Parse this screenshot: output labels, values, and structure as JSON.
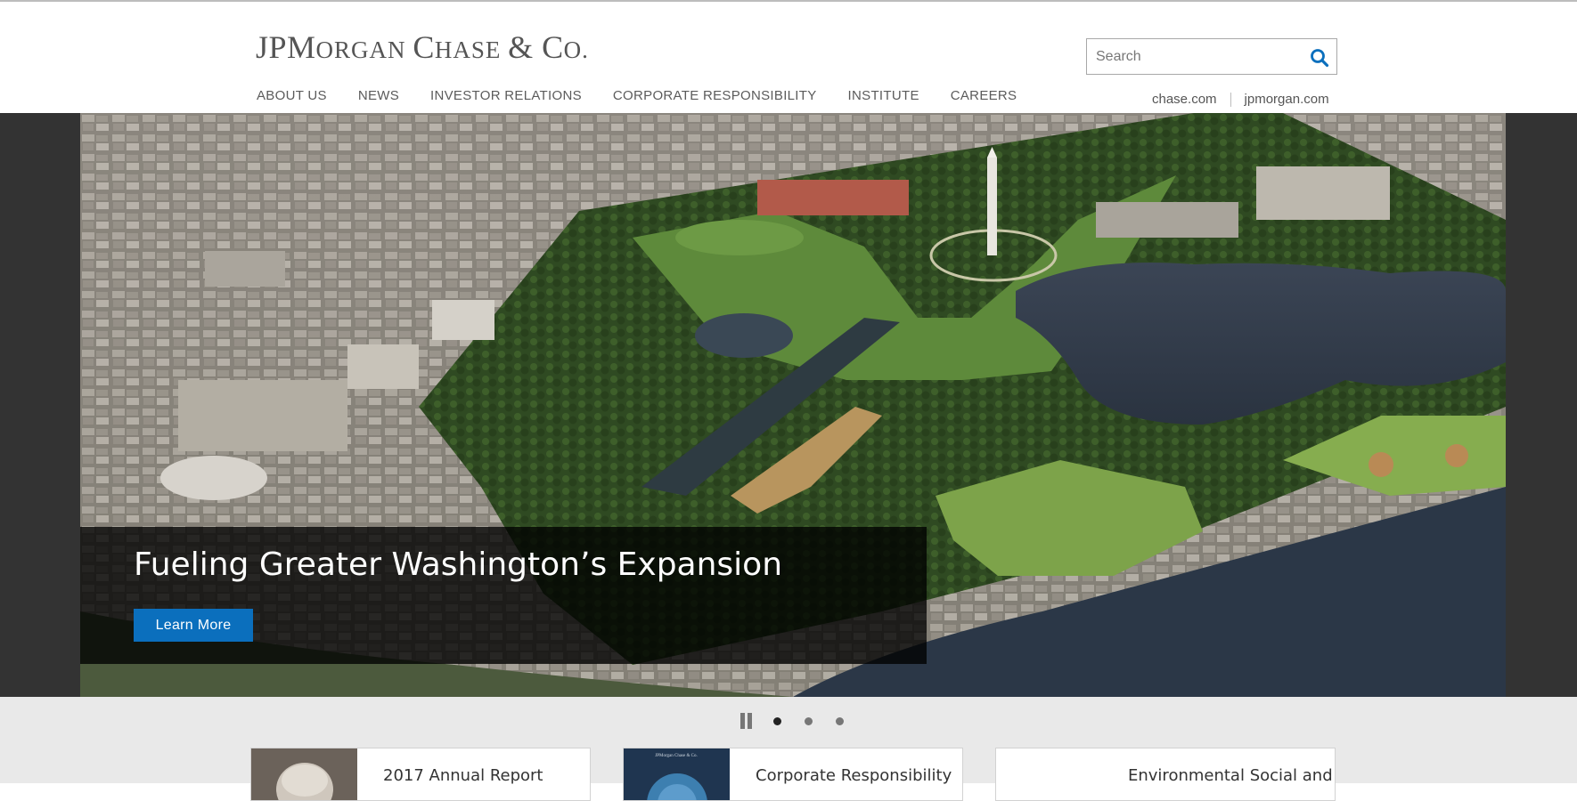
{
  "header": {
    "logo_text": "JPMorgan Chase & Co.",
    "logo_parts": [
      "JPM",
      "ORGAN ",
      "C",
      "HASE ",
      "& C",
      "O."
    ],
    "search_placeholder": "Search",
    "nav": [
      "ABOUT US",
      "NEWS",
      "INVESTOR RELATIONS",
      "CORPORATE RESPONSIBILITY",
      "INSTITUTE",
      "CAREERS"
    ],
    "site_links": [
      "chase.com",
      "jpmorgan.com"
    ]
  },
  "hero": {
    "title": "Fueling Greater Washington’s Expansion",
    "button_label": "Learn More",
    "image_icon": "aerial-washington-dc-photo"
  },
  "carousel": {
    "slide_count": 3,
    "active_slide": 1
  },
  "cards": [
    {
      "title": "2017 Annual Report",
      "thumb_icon": "portrait-photo"
    },
    {
      "title": "Corporate Responsibility",
      "thumb_icon": "report-cover",
      "thumb_caption": "JPMorgan Chase & Co."
    },
    {
      "title": "Environmental Social and",
      "thumb_icon": "blank-thumb"
    }
  ],
  "colors": {
    "accent_blue": "#0b6fbd",
    "nav_text": "#5b5b5b",
    "hero_side": "#333333",
    "band": "#e9e9e9"
  }
}
